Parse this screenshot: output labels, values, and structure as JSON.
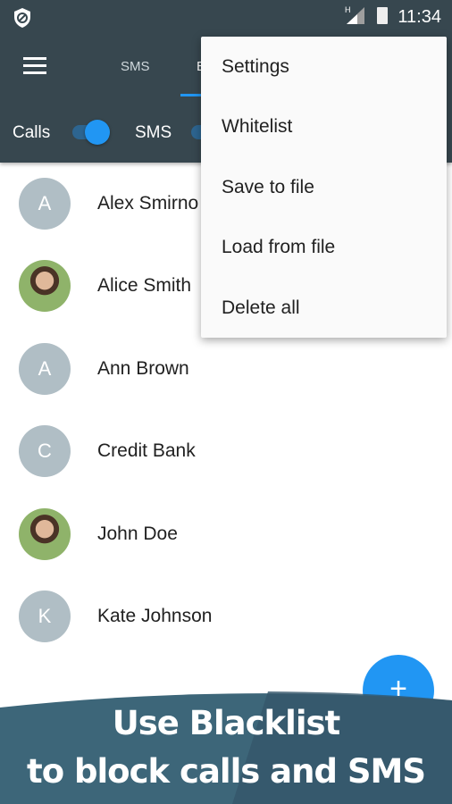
{
  "status": {
    "time": "11:34",
    "network": "H",
    "icons": [
      "shield-block-icon",
      "signal-icon",
      "battery-icon"
    ]
  },
  "toolbar": {
    "tabs": [
      "SMS",
      "B"
    ],
    "active_tab": 1
  },
  "toggles": [
    {
      "label": "Calls",
      "on": true
    },
    {
      "label": "SMS",
      "on": true
    }
  ],
  "contacts": [
    {
      "initial": "A",
      "name": "Alex Smirno",
      "photo": false
    },
    {
      "initial": "",
      "name": "Alice Smith",
      "photo": true
    },
    {
      "initial": "A",
      "name": "Ann Brown",
      "photo": false
    },
    {
      "initial": "C",
      "name": "Credit Bank",
      "photo": false
    },
    {
      "initial": "",
      "name": "John Doe",
      "photo": true
    },
    {
      "initial": "K",
      "name": "Kate Johnson",
      "photo": false
    }
  ],
  "menu": [
    "Settings",
    "Whitelist",
    "Save to file",
    "Load from file",
    "Delete all"
  ],
  "fab": {
    "label": "+"
  },
  "banner": {
    "line1": "Use Blacklist",
    "line2": "to block calls and SMS"
  },
  "colors": {
    "toolbar": "#37474f",
    "accent": "#2196f3",
    "avatar": "#b0bec5"
  }
}
